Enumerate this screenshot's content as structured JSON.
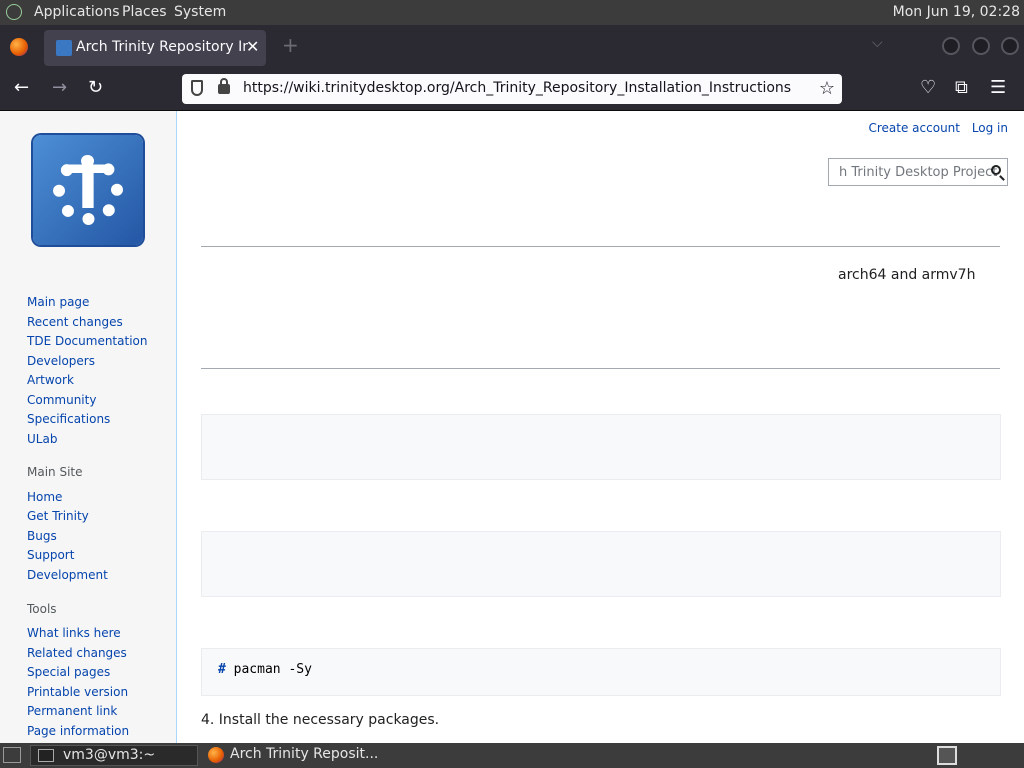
{
  "top_panel": {
    "menu": [
      "Applications",
      "Places",
      "System"
    ],
    "clock": "Mon Jun 19, 02:28"
  },
  "browser": {
    "tab_title": "Arch Trinity Repository Insta",
    "new_tab": "+",
    "tab_close": "✕",
    "tab_list": "⌵",
    "url": "https://wiki.trinitydesktop.org/Arch_Trinity_Repository_Installation_Instructions",
    "nav": {
      "back": "←",
      "forward": "→",
      "reload": "↻"
    },
    "toolbar": {
      "star": "☆",
      "pocket": "♡",
      "extensions": "⧉",
      "menu": "☰"
    }
  },
  "wiki": {
    "logo_letter": "T",
    "personal": [
      "Create account",
      "Log in"
    ],
    "search_placeholder": "h Trinity Desktop Project",
    "sidebar_nav": [
      "Main page",
      "Recent changes",
      "TDE Documentation",
      "Developers",
      "Artwork",
      "Community",
      "Specifications",
      "ULab"
    ],
    "main_site_heading": "Main Site",
    "main_site": [
      "Home",
      "Get Trinity",
      "Bugs",
      "Support",
      "Development"
    ],
    "tools_heading": "Tools",
    "tools": [
      "What links here",
      "Related changes",
      "Special pages",
      "Printable version",
      "Permanent link",
      "Page information"
    ],
    "arch_text": "arch64 and armv7h",
    "code_hash": "#",
    "code_cmd": " pacman -Sy",
    "step4": "4. Install the necessary packages."
  },
  "taskbar": {
    "terminal_task": "vm3@vm3:~",
    "firefox_task": "Arch Trinity Reposit..."
  }
}
